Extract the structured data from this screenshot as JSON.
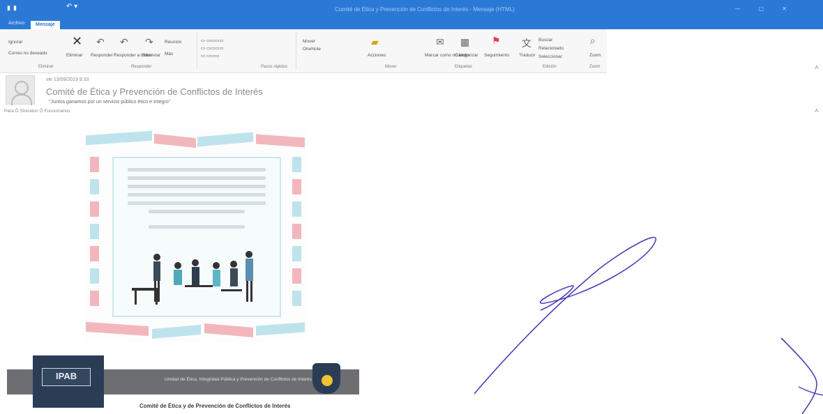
{
  "titlebar": {
    "window_title": "Comité de Ética y Prevención de Conflictos de Interés - Mensaje (HTML)"
  },
  "tabs": [
    "Archivo",
    "Mensaje"
  ],
  "ribbon": {
    "ignore": "Ignorar",
    "junk": "Correo no deseado",
    "delete": "Eliminar",
    "reply": "Responder",
    "reply_all": "Responder a todos",
    "forward": "Reenviar",
    "more": "Más",
    "meeting": "Reunión",
    "move": "Mover",
    "tags_onenote": "OneNote",
    "actions": "Acciones",
    "mark_unread": "Marcar como no leído",
    "categorize": "Categorizar",
    "follow_up": "Seguimiento",
    "translate": "Traducir",
    "find": "Buscar",
    "related": "Relacionado",
    "select": "Seleccionar",
    "zoom": "Zoom",
    "group_delete": "Eliminar",
    "group_respond": "Responder",
    "group_quicksteps": "Pasos rápidos",
    "group_move": "Mover",
    "group_tags": "Etiquetas",
    "group_editing": "Edición",
    "group_zoom": "Zoom"
  },
  "message": {
    "sender": "vie 13/09/2019 9:33",
    "subject": "Comité de Ética y Prevención de Conflictos de Interés",
    "quote": "\"Juntos ganamos por un servicio público ético e íntegro\"",
    "meta": "Para   Ô Sheraton   Ô Funcionarios"
  },
  "flyer": {
    "banner": "Unidad de Ética, Integridad Pública y Prevención de Conflictos de Interés",
    "logo": "IPAB",
    "footer": "Comité de Ética y de Prevención de Conflictos de Interés"
  },
  "colors": {
    "accent": "#2b79d6",
    "stripe_pink": "#f2b7bd",
    "stripe_blue": "#bfe3ec",
    "banner_gray": "#6d6e71",
    "logo_navy": "#2b3d55",
    "signature_ink": "#4a3fb5"
  }
}
